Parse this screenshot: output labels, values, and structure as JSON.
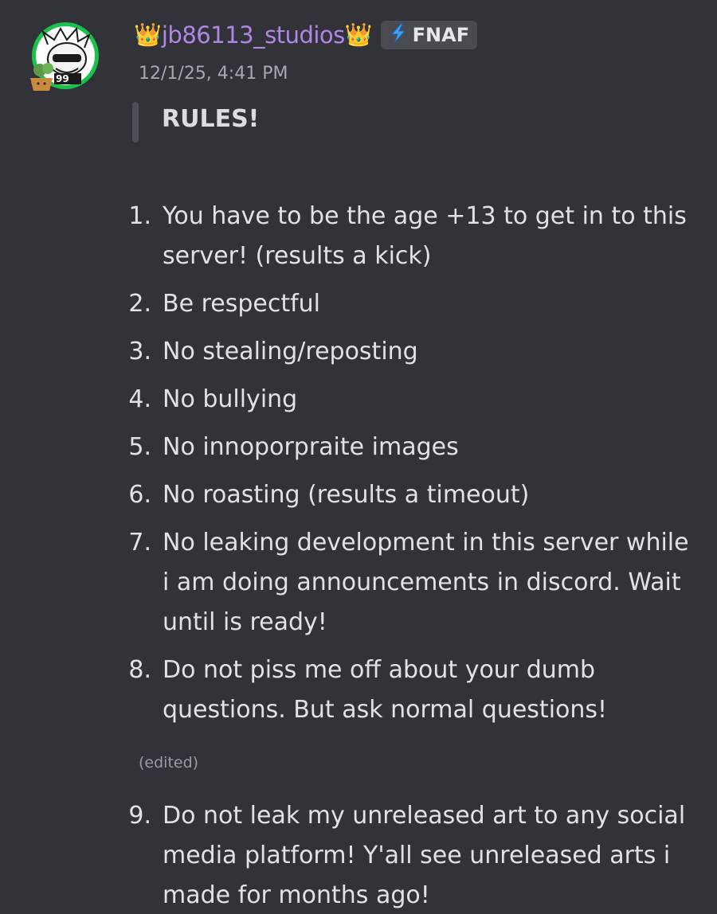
{
  "message": {
    "author": {
      "username": "jb86113_studios",
      "crown_left": "👑",
      "crown_right": "👑",
      "tag": {
        "icon": "lightning-bolt-icon",
        "label": "FNAF"
      },
      "avatar": {
        "badge_text": "99"
      },
      "name_color": "#b086e4"
    },
    "timestamp": "12/1/25, 4:41 PM",
    "blockquote": "RULES!",
    "rules": [
      {
        "num": "1.",
        "text": "You have to be the age +13 to get in to this server! (results a kick)"
      },
      {
        "num": "2.",
        "text": "Be respectful"
      },
      {
        "num": "3.",
        "text": "No stealing/reposting"
      },
      {
        "num": "4.",
        "text": "No bullying"
      },
      {
        "num": "5.",
        "text": "No innoporpraite images"
      },
      {
        "num": "6.",
        "text": "No roasting (results a timeout)"
      },
      {
        "num": "7.",
        "text": "No leaking development in this server while i am doing announcements in discord. Wait until is ready!"
      },
      {
        "num": "8.",
        "text": "Do not piss me off about your dumb questions. But ask normal questions!"
      }
    ],
    "edited_label": "(edited)",
    "rules_after_edit": [
      {
        "num": "9.",
        "text": "Do not leak my unreleased art to any social media platform! Y'all see unreleased arts i made for months ago!"
      }
    ]
  }
}
